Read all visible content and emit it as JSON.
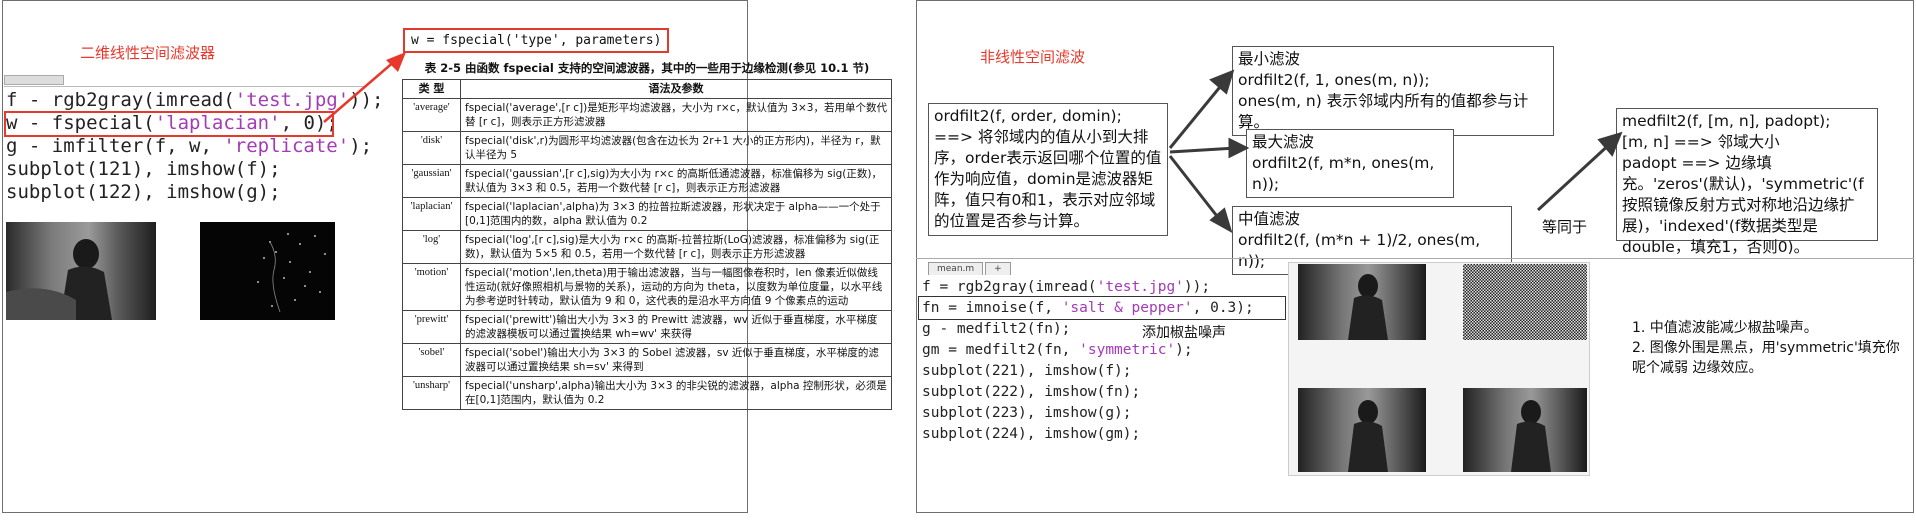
{
  "left": {
    "heading": "二维线性空间滤波器",
    "fspecial_call": "w = fspecial('type', parameters)",
    "code": [
      {
        "parts": [
          {
            "t": "f - rgb2gray(imread("
          },
          {
            "t": "'test.jpg'",
            "s": true
          },
          {
            "t": "));"
          }
        ]
      },
      {
        "parts": [
          {
            "t": "w - fspecial("
          },
          {
            "t": "'laplacian'",
            "s": true
          },
          {
            "t": ", 0);"
          }
        ]
      },
      {
        "parts": [
          {
            "t": "g - imfilter(f, w, "
          },
          {
            "t": "'replicate'",
            "s": true
          },
          {
            "t": ");"
          }
        ]
      },
      {
        "parts": [
          {
            "t": "subplot(121), imshow(f);"
          }
        ]
      },
      {
        "parts": [
          {
            "t": "subplot(122), imshow(g);"
          }
        ]
      }
    ],
    "table": {
      "caption": "表 2-5   由函数 fspecial 支持的空间滤波器，其中的一些用于边缘检测(参见 10.1 节)",
      "headers": [
        "类 型",
        "语法及参数"
      ],
      "rows": [
        [
          "'average'",
          "fspecial('average',[r c])是矩形平均滤波器，大小为 r×c，默认值为 3×3，若用单个数代替 [r c]，则表示正方形滤波器"
        ],
        [
          "'disk'",
          "fspecial('disk',r)为圆形平均滤波器(包含在边长为 2r+1 大小的正方形内)，半径为 r，默认半径为 5"
        ],
        [
          "'gaussian'",
          "fspecial('gaussian',[r c],sig)为大小为 r×c 的高斯低通滤波器，标准偏移为 sig(正数)，默认值为 3×3 和 0.5，若用一个数代替 [r c]，则表示正方形滤波器"
        ],
        [
          "'laplacian'",
          "fspecial('laplacian',alpha)为 3×3 的拉普拉斯滤波器，形状决定于 alpha——一个处于[0,1]范围内的数，alpha 默认值为 0.2"
        ],
        [
          "'log'",
          "fspecial('log',[r c],sig)是大小为 r×c 的高斯-拉普拉斯(LoG)滤波器，标准偏移为 sig(正数)，默认值为 5×5 和 0.5，若用一个数代替 [r c]，则表示正方形滤波器"
        ],
        [
          "'motion'",
          "fspecial('motion',len,theta)用于输出滤波器，当与一幅图像卷积时，len 像素近似做线性运动(就好像照相机与景物的关系)，运动的方向为 theta，以度数为单位度量，以水平线为参考逆时针转动，默认值为 9 和 0，这代表的是沿水平方向值 9 个像素点的运动"
        ],
        [
          "'prewitt'",
          "fspecial('prewitt')输出大小为 3×3 的 Prewitt 滤波器，wv 近似于垂直梯度，水平梯度的滤波器模板可以通过置换结果 wh=wv' 来获得"
        ],
        [
          "'sobel'",
          "fspecial('sobel')输出大小为 3×3 的 Sobel 滤波器，sv 近似于垂直梯度，水平梯度的滤波器可以通过置换结果 sh=sv' 来得到"
        ],
        [
          "'unsharp'",
          "fspecial('unsharp',alpha)输出大小为 3×3 的非尖锐的滤波器，alpha 控制形状，必须是在[0,1]范围内，默认值为 0.2"
        ]
      ]
    }
  },
  "right": {
    "heading": "非线性空间滤波",
    "ordfilt_desc": "ordfilt2(f, order, domin); ==> 将邻域内的值从小到大排序，order表示返回哪个位置的值作为响应值，domin是滤波器矩阵，值只有0和1，表示对应邻域的位置是否参与计算。",
    "min_filter": {
      "title": "最小滤波",
      "line1": "ordfilt2(f, 1, ones(m, n));",
      "line2": "ones(m, n) 表示邻域内所有的值都参与计算。"
    },
    "max_filter": {
      "title": "最大滤波",
      "line1": "ordfilt2(f, m*n, ones(m, n));"
    },
    "median_filter": {
      "title": "中值滤波",
      "line1": "ordfilt2(f, (m*n + 1)/2, ones(m, n));"
    },
    "equals_label": "等同于",
    "medfilt_desc": {
      "line1": "medfilt2(f, [m, n], padopt);",
      "line2": "[m, n] ==> 邻域大小",
      "rest": "padopt ==> 边缘填充。'zeros'(默认)，'symmetric'(f按照镜像反射方式对称地沿边缘扩展)，'indexed'(f数据类型是double，填充1，否则0)。"
    },
    "editor_tabs": [
      "mean.m",
      "+"
    ],
    "code": [
      {
        "parts": [
          {
            "t": "f = rgb2gray(imread("
          },
          {
            "t": "'test.jpg'",
            "s": true
          },
          {
            "t": "));"
          }
        ]
      },
      {
        "parts": [
          {
            "t": "fn = imnoise(f, "
          },
          {
            "t": "'salt & pepper'",
            "s": true
          },
          {
            "t": ", 0.3);"
          }
        ]
      },
      {
        "parts": [
          {
            "t": "g - medfilt2(fn);"
          }
        ]
      },
      {
        "parts": [
          {
            "t": "gm = medfilt2(fn, "
          },
          {
            "t": "'symmetric'",
            "s": true
          },
          {
            "t": ");"
          }
        ]
      },
      {
        "parts": [
          {
            "t": "subplot(221), imshow(f);"
          }
        ]
      },
      {
        "parts": [
          {
            "t": "subplot(222), imshow(fn);"
          }
        ]
      },
      {
        "parts": [
          {
            "t": "subplot(223), imshow(g);"
          }
        ]
      },
      {
        "parts": [
          {
            "t": "subplot(224), imshow(gm);"
          }
        ]
      }
    ],
    "noise_note": "添加椒盐噪声",
    "notes": [
      "1. 中值滤波能减少椒盐噪声。",
      "2. 图像外围是黑点，用'symmetric'填充你呢个减弱 边缘效应。"
    ]
  },
  "colors": {
    "accent_red": "#e8382c",
    "string_purple": "#a23bb5",
    "arrow_dark": "#3a3a3a"
  }
}
